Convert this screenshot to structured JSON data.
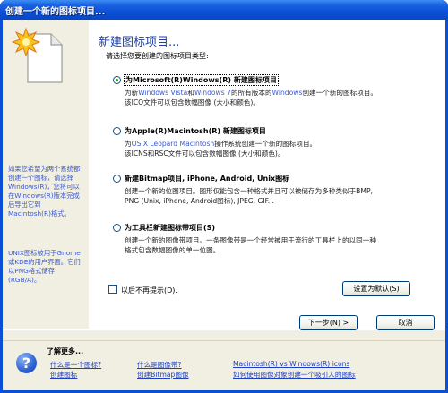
{
  "window": {
    "title": "创建一个新的图标项目..."
  },
  "side": {
    "text1": "如果您希望为两个系统都创建一个图标，请选择Windows(R)，您将可以在Windows(R)版本完成后导出它到Macintosh(R)格式。",
    "text2": "UNIX图标被用于Gnome或KDE的用户界面。它们以PNG格式储存(RGB/A)。"
  },
  "main": {
    "heading": "新建图标项目...",
    "subheading": "请选择您要创建的图标项目类型:",
    "options": [
      {
        "label": "为Microsoft(R)Windows(R) 新建图标项目",
        "selected": true,
        "desc_parts": [
          {
            "text": "为新",
            "blue": false
          },
          {
            "text": "Windows Vista",
            "blue": true
          },
          {
            "text": "和",
            "blue": false
          },
          {
            "text": "Windows 7",
            "blue": true
          },
          {
            "text": "的所有版本的",
            "blue": false
          },
          {
            "text": "Windows",
            "blue": true
          },
          {
            "text": "创建一个新的图标项目。\n该ICO文件可以包含数幅图像 (大小和颜色)。",
            "blue": false
          }
        ]
      },
      {
        "label": "为Apple(R)Macintosh(R) 新建图标项目",
        "selected": false,
        "desc_parts": [
          {
            "text": "为",
            "blue": false
          },
          {
            "text": "OS X Leopard Macintosh",
            "blue": true
          },
          {
            "text": "操作系统创建一个新的图标项目。\n该ICNS和RSC文件可以包含数幅图像 (大小和颜色)。",
            "blue": false
          }
        ]
      },
      {
        "label": "新建Bitmap项目, iPhone, Android, Unix图标",
        "selected": false,
        "desc_parts": [
          {
            "text": "创建一个新的位图项目。图形仅能包含一种格式并且可以被储存为多种类似于BMP,\nPNG (Unix, iPhone, Android图标), JPEG, GIF...",
            "blue": false
          }
        ]
      },
      {
        "label": "为工具栏新建图标带项目(S)",
        "selected": false,
        "desc_parts": [
          {
            "text": "创建一个新的图像带项目。一条图像带是一个经常被用于流行的工具栏上的以同一种\n格式包含数幅图像的单一位图。",
            "blue": false
          }
        ]
      }
    ],
    "checkbox_label": "以后不再提示(D).",
    "checkbox_checked": false,
    "default_button": "设置为默认(S)"
  },
  "nav": {
    "next_button": "下一步(N) >",
    "cancel_button": "取消"
  },
  "info": {
    "more_label": "了解更多...",
    "links": [
      "什么是一个图标?",
      "创建图标",
      "什么是图像带?",
      "创建Bitmap图像",
      "Macintosh(R) vs Windows(R) icons",
      "如何使用图像对象创建一个吸引人的图标"
    ]
  },
  "colors": {
    "titlebar": "#0a50d8",
    "dialog_bg": "#f1efe2",
    "heading": "#1b3fa8",
    "link": "#1f3fc1"
  },
  "icons": {
    "document": "document-new-icon",
    "help": "help-icon",
    "burst": "starburst-icon"
  }
}
